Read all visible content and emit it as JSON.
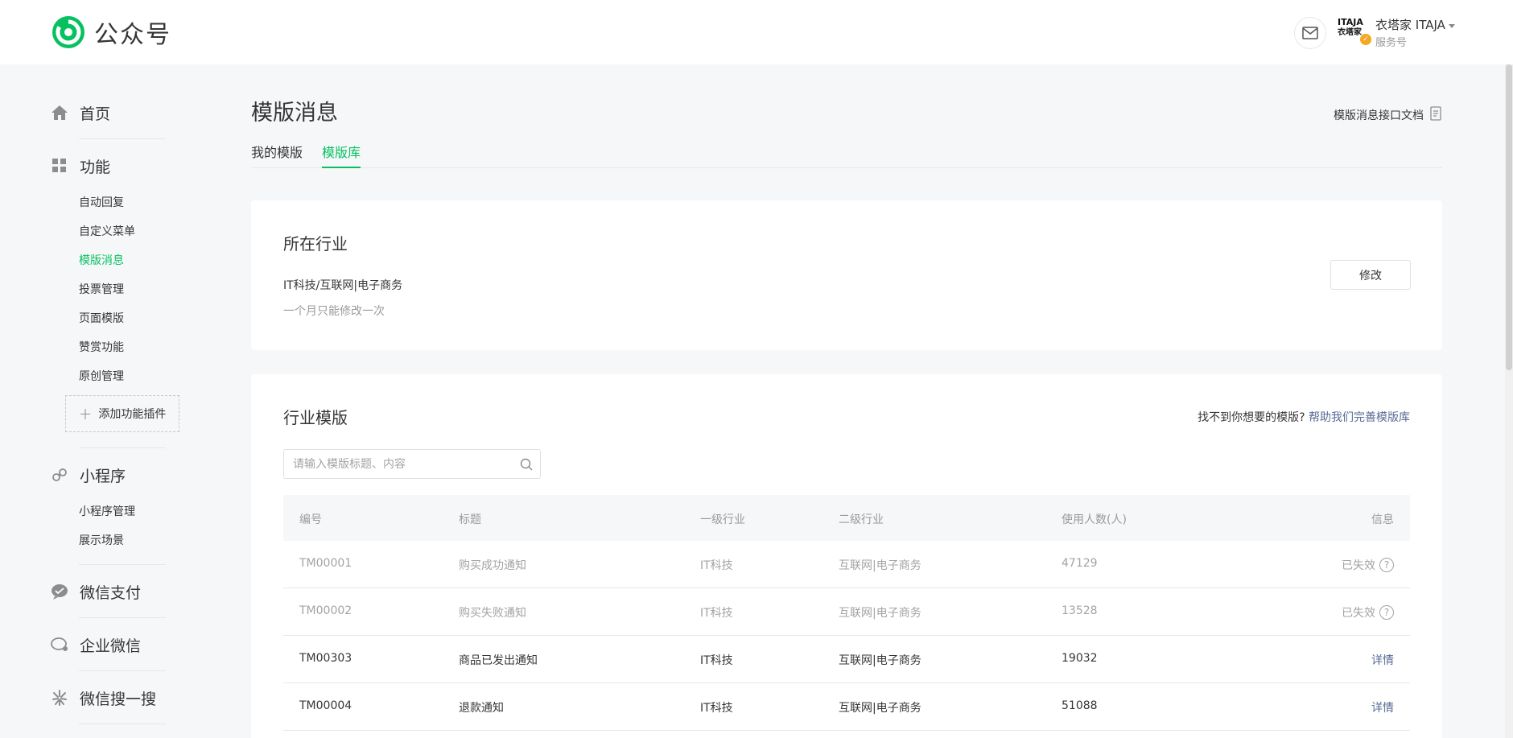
{
  "header": {
    "logo_text": "公众号",
    "account_logo_line1": "ITAJA",
    "account_logo_line2": "衣塔家",
    "account_name": "衣塔家 ITAJA",
    "account_type": "服务号"
  },
  "sidebar": {
    "home": "首页",
    "features": "功能",
    "feature_items": [
      "自动回复",
      "自定义菜单",
      "模版消息",
      "投票管理",
      "页面模版",
      "赞赏功能",
      "原创管理"
    ],
    "add_plugin": "添加功能插件",
    "miniprogram": "小程序",
    "miniprogram_items": [
      "小程序管理",
      "展示场景"
    ],
    "pay": "微信支付",
    "work": "企业微信",
    "search": "微信搜一搜"
  },
  "main": {
    "title": "模版消息",
    "doc_link": "模版消息接口文档",
    "tabs": [
      "我的模版",
      "模版库"
    ],
    "industry": {
      "title": "所在行业",
      "value": "IT科技/互联网|电子商务",
      "note": "一个月只能修改一次",
      "edit_button": "修改"
    },
    "templates": {
      "title": "行业模版",
      "help_prefix": "找不到你想要的模版?",
      "help_link": "帮助我们完善模版库",
      "search_placeholder": "请输入模版标题、内容",
      "columns": [
        "编号",
        "标题",
        "一级行业",
        "二级行业",
        "使用人数(人)",
        "信息"
      ],
      "rows": [
        {
          "id": "TM00001",
          "title": "购买成功通知",
          "industry1": "IT科技",
          "industry2": "互联网|电子商务",
          "users": "47129",
          "info": "已失效"
        },
        {
          "id": "TM00002",
          "title": "购买失败通知",
          "industry1": "IT科技",
          "industry2": "互联网|电子商务",
          "users": "13528",
          "info": "已失效"
        },
        {
          "id": "TM00303",
          "title": "商品已发出通知",
          "industry1": "IT科技",
          "industry2": "互联网|电子商务",
          "users": "19032",
          "info": "详情"
        },
        {
          "id": "TM00004",
          "title": "退款通知",
          "industry1": "IT科技",
          "industry2": "互联网|电子商务",
          "users": "51088",
          "info": "详情"
        }
      ]
    }
  },
  "colors": {
    "brand_green": "#07c160",
    "link_blue": "#576b95"
  }
}
